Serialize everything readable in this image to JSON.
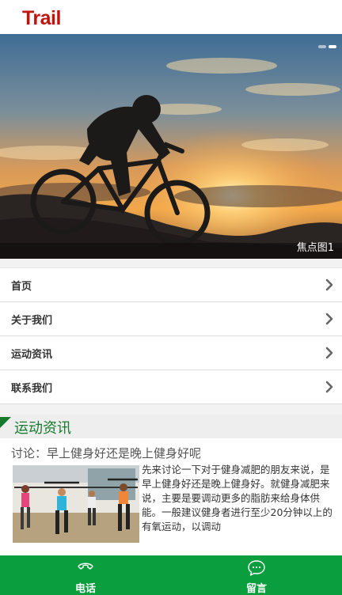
{
  "header": {
    "logo_text": "Trail"
  },
  "banner": {
    "caption": "焦点图1",
    "slide_count": 2,
    "active_slide": 1
  },
  "menu": {
    "items": [
      {
        "label": "首页"
      },
      {
        "label": "关于我们"
      },
      {
        "label": "运动资讯"
      },
      {
        "label": "联系我们"
      }
    ]
  },
  "news": {
    "section_title": "运动资讯",
    "article": {
      "title": "讨论：早上健身好还是晚上健身好呢",
      "excerpt": "先来讨论一下对于健身减肥的朋友来说，是早上健身好还是晚上健身好。就健身减肥来说，主要是要调动更多的脂肪来给身体供能。一般建议健身者进行至少20分钟以上的有氧运动，以调动"
    }
  },
  "footer": {
    "phone_label": "电话",
    "message_label": "留言"
  },
  "colors": {
    "logo": "#c0140f",
    "accent_green": "#167a2c",
    "footer_bg": "#0a9e3e"
  }
}
